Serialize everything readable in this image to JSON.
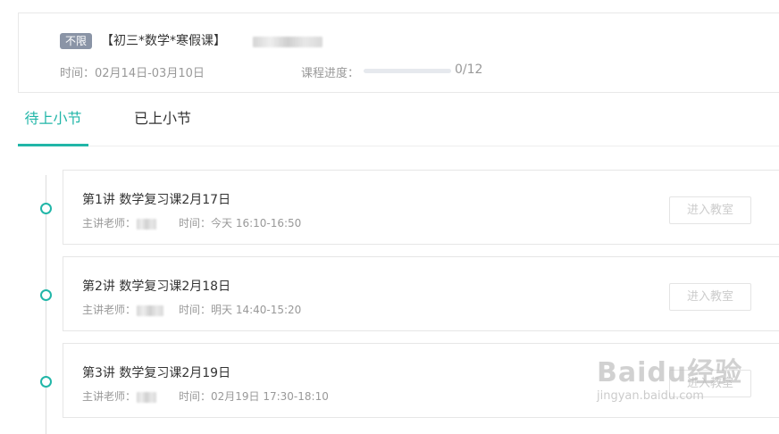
{
  "course": {
    "badge": "不限",
    "title": "【初三*数学*寒假课】",
    "time": "时间：02月14日-03月10日",
    "progress_label": "课程进度：",
    "progress_fraction": 0,
    "progress_count": "0/12"
  },
  "tabs": [
    {
      "label": "待上小节",
      "active": true
    },
    {
      "label": "已上小节",
      "active": false
    }
  ],
  "lessons": [
    {
      "title": "第1讲 数学复习课2月17日",
      "teacher_label": "主讲老师：",
      "time": "时间：今天 16:10-16:50",
      "button": "进入教室"
    },
    {
      "title": "第2讲 数学复习课2月18日",
      "teacher_label": "主讲老师：",
      "time": "时间：明天 14:40-15:20",
      "button": "进入教室"
    },
    {
      "title": "第3讲 数学复习课2月19日",
      "teacher_label": "主讲老师：",
      "time": "时间：02月19日 17:30-18:10",
      "button": "进入教室"
    }
  ],
  "watermark": {
    "brand": "Baidu经验",
    "url": "jingyan.baidu.com"
  },
  "colors": {
    "accent": "#21b6a8",
    "badge_bg": "#8a94a6"
  }
}
